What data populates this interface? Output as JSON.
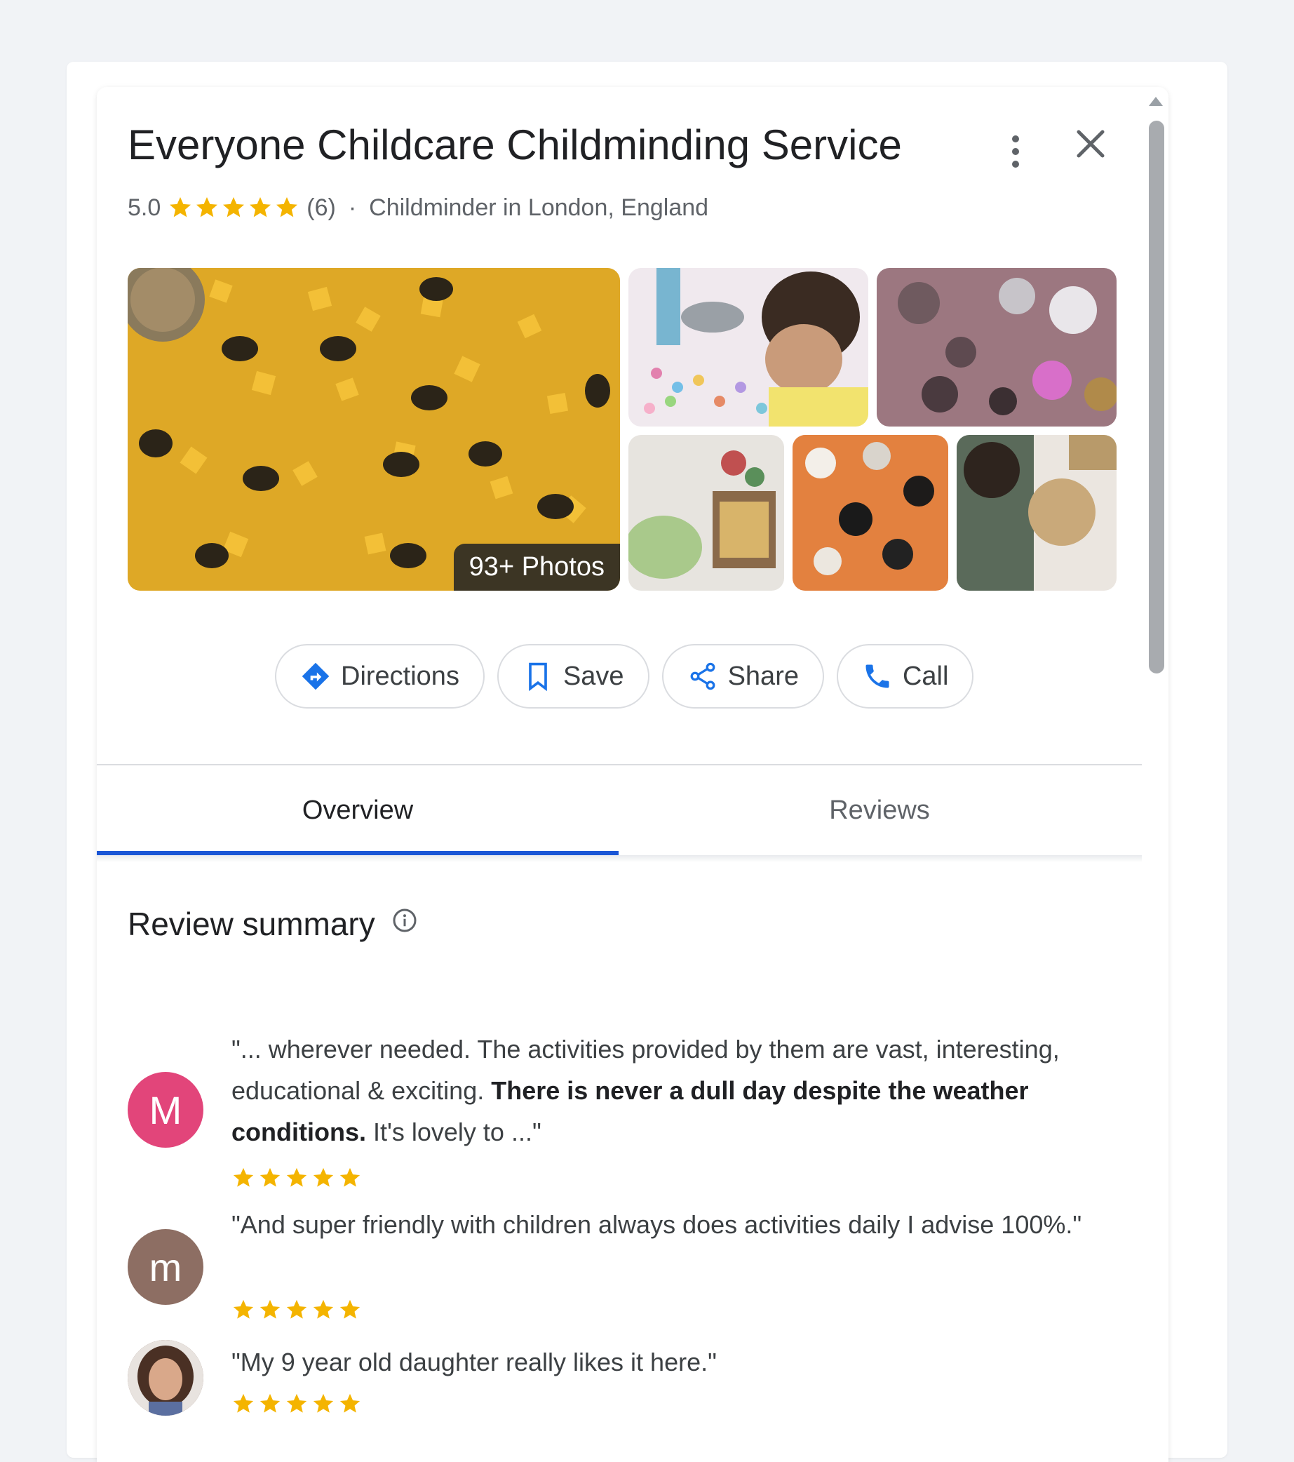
{
  "place": {
    "title": "Everyone Childcare Childminding Service",
    "rating": "5.0",
    "review_count": "(6)",
    "separator": "·",
    "category": "Childminder in London, England"
  },
  "photos": {
    "badge": "93+ Photos"
  },
  "actions": {
    "directions": "Directions",
    "save": "Save",
    "share": "Share",
    "call": "Call"
  },
  "tabs": {
    "overview": "Overview",
    "reviews": "Reviews"
  },
  "review_summary": {
    "heading": "Review summary",
    "reviews": [
      {
        "avatar_letter": "M",
        "avatar_color": "#e2457a",
        "text_before": "\"... wherever needed. The activities provided by them are vast, interesting, educational & exciting. ",
        "text_bold": "There is never a dull day despite the weather conditions.",
        "text_after": " It's lovely to ...\"",
        "stars": 5
      },
      {
        "avatar_letter": "m",
        "avatar_color": "#8d6e63",
        "text_before": "\"And super friendly with children always does activities daily I advise 100%.\"",
        "text_bold": "",
        "text_after": "",
        "stars": 5
      },
      {
        "avatar_letter": "",
        "avatar_color": "#6d4c3d",
        "text_before": "\"My 9 year old daughter really likes it here.\"",
        "text_bold": "",
        "text_after": "",
        "stars": 5
      }
    ]
  },
  "colors": {
    "star": "#f4b400",
    "accent": "#1a56d6",
    "tab_active": "#1a56d6"
  }
}
